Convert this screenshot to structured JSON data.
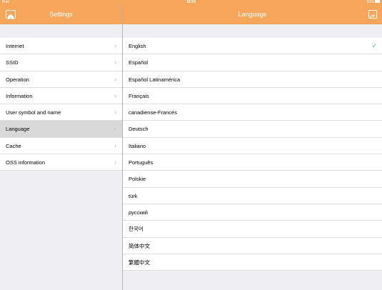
{
  "status": {
    "carrier": "iPad",
    "time": "18:54",
    "battery": "81%"
  },
  "left_nav": {
    "title": "Settings",
    "home_icon": "home-icon"
  },
  "right_nav": {
    "title": "Language",
    "share_icon": "share-icon"
  },
  "settings_items": [
    {
      "label": "Internet"
    },
    {
      "label": "SSID"
    },
    {
      "label": "Operation"
    },
    {
      "label": "Information"
    },
    {
      "label": "User symbol and name"
    },
    {
      "label": "Language",
      "selected": true
    },
    {
      "label": "Cache"
    },
    {
      "label": "OSS information"
    }
  ],
  "languages": [
    {
      "label": "English",
      "checked": true
    },
    {
      "label": "Español"
    },
    {
      "label": "Español Latinamérica"
    },
    {
      "label": "Français"
    },
    {
      "label": "canadiense-Francés"
    },
    {
      "label": "Deutsch"
    },
    {
      "label": "Italiano"
    },
    {
      "label": "Português"
    },
    {
      "label": "Polskie"
    },
    {
      "label": "türk"
    },
    {
      "label": "русский"
    },
    {
      "label": "한국어"
    },
    {
      "label": "简体中文"
    },
    {
      "label": "繁體中文"
    }
  ],
  "colors": {
    "accent": "#f5a65b",
    "check": "#3bb5c3",
    "selected_row": "#d9d9d9"
  }
}
